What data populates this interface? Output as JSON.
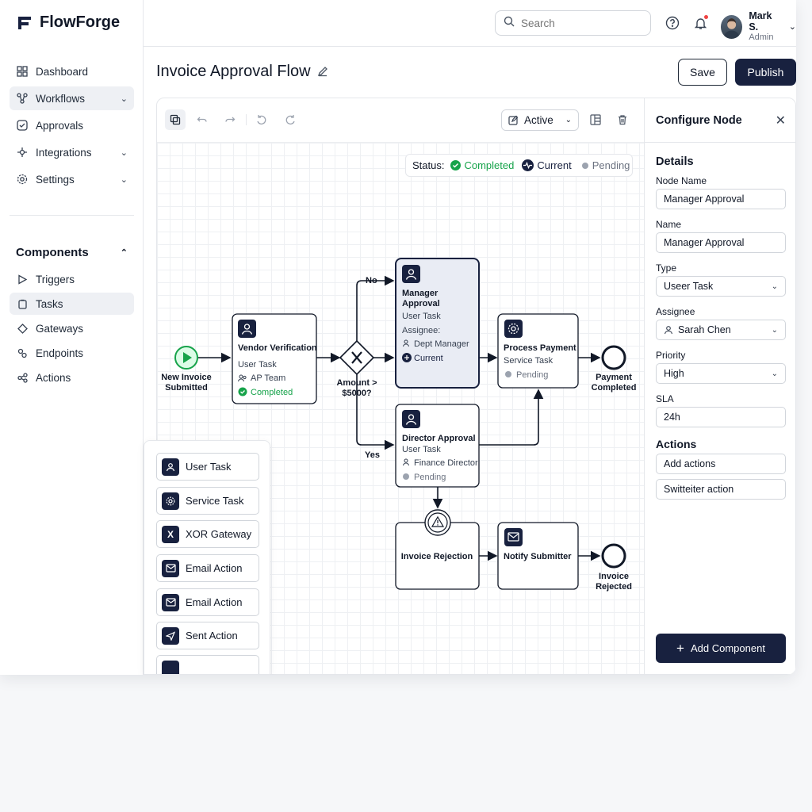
{
  "app": {
    "brand": "FlowForge"
  },
  "sidebar": {
    "nav": [
      {
        "label": "Dashboard",
        "icon": "grid-icon",
        "expandable": false
      },
      {
        "label": "Workflows",
        "icon": "workflow-icon",
        "expandable": true,
        "active": true
      },
      {
        "label": "Approvals",
        "icon": "check-circle-icon",
        "expandable": false
      },
      {
        "label": "Integrations",
        "icon": "integrations-icon",
        "expandable": true
      },
      {
        "label": "Settings",
        "icon": "gear-icon",
        "expandable": true
      }
    ],
    "components_heading": "Components",
    "components": [
      {
        "label": "Triggers",
        "icon": "play-icon"
      },
      {
        "label": "Tasks",
        "icon": "clipboard-icon",
        "active": true
      },
      {
        "label": "Gateways",
        "icon": "diamond-icon"
      },
      {
        "label": "Endpoints",
        "icon": "circles-icon"
      },
      {
        "label": "Actions",
        "icon": "share-icon"
      }
    ]
  },
  "topbar": {
    "search_placeholder": "Search",
    "user_name": "Mark S.",
    "user_role": "Admin"
  },
  "page": {
    "title": "Invoice Approval Flow",
    "save_label": "Save",
    "publish_label": "Publish"
  },
  "toolbar": {
    "status_filter": "Active"
  },
  "legend": {
    "label": "Status:",
    "completed": "Completed",
    "current": "Current",
    "pending": "Pending"
  },
  "diagram": {
    "start": {
      "label_line1": "New Invoice",
      "label_line2": "Submitted"
    },
    "vendor": {
      "title": "Vendor Verification",
      "type": "User Task",
      "assignee": "AP Team",
      "status": "Completed"
    },
    "gateway": {
      "label_line1": "Amount >",
      "label_line2": "$5000?",
      "no": "No",
      "yes": "Yes"
    },
    "manager": {
      "title_line1": "Manager",
      "title_line2": "Approval",
      "type": "User Task",
      "assignee_label": "Assignee:",
      "assignee": "Dept Manager",
      "status": "Current"
    },
    "director": {
      "title": "Director Approval",
      "type": "User Task",
      "assignee": "Finance Director",
      "status": "Pending"
    },
    "payment": {
      "title": "Process Payment",
      "type": "Service Task",
      "status": "Pending"
    },
    "payment_end": {
      "label_line1": "Payment",
      "label_line2": "Completed"
    },
    "rejection": {
      "title": "Invoice Rejection"
    },
    "notify": {
      "title": "Notify Submitter"
    },
    "rejected_end": {
      "label_line1": "Invoice",
      "label_line2": "Rejected"
    }
  },
  "palette": [
    {
      "label": "User Task",
      "icon": "user-icon"
    },
    {
      "label": "Service Task",
      "icon": "gear-icon"
    },
    {
      "label": "XOR Gateway",
      "icon": "x-icon"
    },
    {
      "label": "Email Action",
      "icon": "mail-icon"
    },
    {
      "label": "Email Action",
      "icon": "mail-icon"
    },
    {
      "label": "Sent Action",
      "icon": "send-icon"
    }
  ],
  "panel": {
    "title": "Configure Node",
    "details_heading": "Details",
    "fields": {
      "node_name_label": "Node Name",
      "node_name": "Manager Approval",
      "name_label": "Name",
      "name": "Manager Approval",
      "type_label": "Type",
      "type": "Useer Task",
      "assignee_label": "Assignee",
      "assignee": "Sarah Chen",
      "priority_label": "Priority",
      "priority": "High",
      "sla_label": "SLA",
      "sla": "24h"
    },
    "actions_heading": "Actions",
    "action_1": "Add actions",
    "action_2": "Switteiter action",
    "add_component": "Add Component"
  },
  "colors": {
    "navy": "#18213f",
    "completed": "#16a34a",
    "pending": "#9ca3af",
    "current_bg": "#e9ecf4"
  }
}
